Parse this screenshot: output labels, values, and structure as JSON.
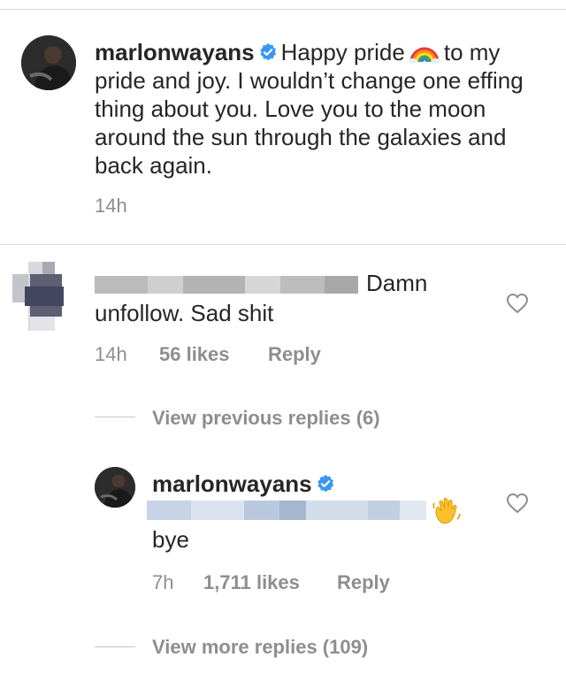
{
  "post": {
    "username": "marlonwayans",
    "caption_before_emoji": "Happy pride",
    "caption_after_emoji": "to my pride and joy. I wouldn’t change one effing thing about you. Love you to the moon around the sun through the galaxies and back again.",
    "time": "14h",
    "emoji": "rainbow-emoji"
  },
  "comment": {
    "text_tail": "Damn",
    "text_line2": "unfollow. Sad shit",
    "time": "14h",
    "likes": "56 likes",
    "reply_label": "Reply"
  },
  "view_previous": "View previous replies (6)",
  "reply": {
    "username": "marlonwayans",
    "text": "bye",
    "emoji": "waving-hand-emoji",
    "time": "7h",
    "likes": "1,711 likes",
    "reply_label": "Reply"
  },
  "view_more": "View more replies (109)",
  "colors": {
    "text": "#262626",
    "muted": "#8e8e8e",
    "verified": "#3897f0",
    "divider": "#dbdbdb"
  }
}
